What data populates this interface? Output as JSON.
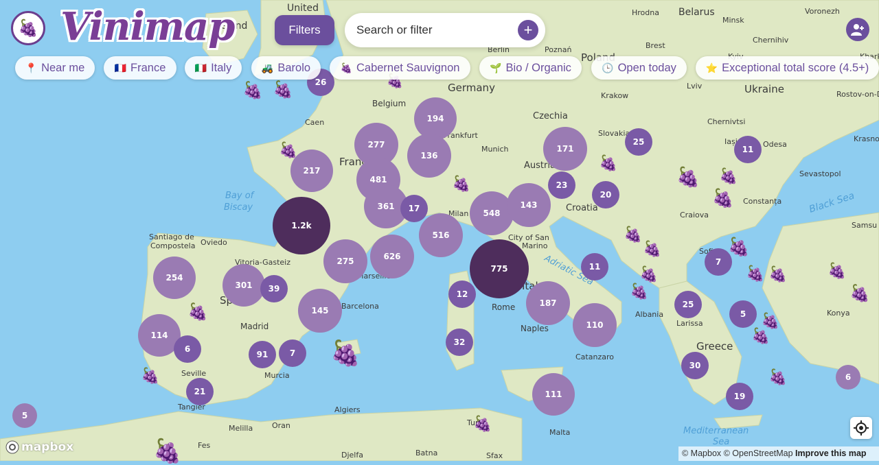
{
  "app": {
    "name": "Vinimap"
  },
  "header": {
    "filters_label": "Filters",
    "search_placeholder": "Search or filter",
    "search_add": "+"
  },
  "chips": [
    {
      "emoji": "📍",
      "label": "Near me"
    },
    {
      "emoji": "🇫🇷",
      "label": "France"
    },
    {
      "emoji": "🇮🇹",
      "label": "Italy"
    },
    {
      "emoji": "🚜",
      "label": "Barolo"
    },
    {
      "emoji": "🍇",
      "label": "Cabernet Sauvignon"
    },
    {
      "emoji": "🌱",
      "label": "Bio / Organic"
    },
    {
      "emoji": "🕒",
      "label": "Open today"
    },
    {
      "emoji": "⭐",
      "label": "Exceptional total score (4.5+)"
    }
  ],
  "place_labels": [
    "United",
    "Ireland",
    "Belarus",
    "Hrodna",
    "Voronezh",
    "Minsk",
    "Chernihiv",
    "Brest",
    "Poznań",
    "Berlin",
    "Poland",
    "Kyiv",
    "Rostov-on-D",
    "Germany",
    "Ukraine",
    "Belgium",
    "Lviv",
    "Krakow",
    "Kharkiv",
    "Czechia",
    "Caen",
    "Frankfurt",
    "Munich",
    "Slovakia",
    "Chernivtsi",
    "Iași",
    "Odesa",
    "Krasnod",
    "Austria",
    "Sevastopol",
    "France",
    "Croatia",
    "Constanța",
    "Bay of",
    "Biscay",
    "Milan",
    "Craiova",
    "Santiago de",
    "Compostela",
    "Oviedo",
    "City of San",
    "Marino",
    "Sofia",
    "Samsu",
    "Vitoria-Gasteiz",
    "Spain",
    "Marseille",
    "Barcelona",
    "Madrid",
    "Italy",
    "Rome",
    "Albania",
    "Larissa",
    "Konya",
    "Naples",
    "Greece",
    "Catanzaro",
    "Seville",
    "Murcia",
    "Tangier",
    "Algiers",
    "Malta",
    "Melilla",
    "Oran",
    "Tunis",
    "Sfax",
    "Fes",
    "Djelfa",
    "Batna",
    "Mediterranean",
    "Sea",
    "Adriatic Sea",
    "Black Sea"
  ],
  "clusters": [
    {
      "label": "26",
      "tone": "mid"
    },
    {
      "label": "194",
      "tone": "light"
    },
    {
      "label": "277",
      "tone": "light"
    },
    {
      "label": "136",
      "tone": "light"
    },
    {
      "label": "171",
      "tone": "light"
    },
    {
      "label": "25",
      "tone": "mid"
    },
    {
      "label": "11",
      "tone": "mid"
    },
    {
      "label": "217",
      "tone": "light"
    },
    {
      "label": "481",
      "tone": "light"
    },
    {
      "label": "23",
      "tone": "mid"
    },
    {
      "label": "20",
      "tone": "mid"
    },
    {
      "label": "361",
      "tone": "light"
    },
    {
      "label": "17",
      "tone": "mid"
    },
    {
      "label": "548",
      "tone": "light"
    },
    {
      "label": "143",
      "tone": "light"
    },
    {
      "label": "1.2k",
      "tone": "dark"
    },
    {
      "label": "516",
      "tone": "light"
    },
    {
      "label": "626",
      "tone": "light"
    },
    {
      "label": "275",
      "tone": "light"
    },
    {
      "label": "775",
      "tone": "dark"
    },
    {
      "label": "11",
      "tone": "mid"
    },
    {
      "label": "7",
      "tone": "mid"
    },
    {
      "label": "254",
      "tone": "light"
    },
    {
      "label": "301",
      "tone": "light"
    },
    {
      "label": "39",
      "tone": "mid"
    },
    {
      "label": "12",
      "tone": "mid"
    },
    {
      "label": "187",
      "tone": "light"
    },
    {
      "label": "25",
      "tone": "mid"
    },
    {
      "label": "5",
      "tone": "mid"
    },
    {
      "label": "145",
      "tone": "light"
    },
    {
      "label": "110",
      "tone": "light"
    },
    {
      "label": "114",
      "tone": "light"
    },
    {
      "label": "6",
      "tone": "mid"
    },
    {
      "label": "32",
      "tone": "mid"
    },
    {
      "label": "91",
      "tone": "mid"
    },
    {
      "label": "7",
      "tone": "mid"
    },
    {
      "label": "30",
      "tone": "mid"
    },
    {
      "label": "6",
      "tone": "light"
    },
    {
      "label": "21",
      "tone": "mid"
    },
    {
      "label": "111",
      "tone": "light"
    },
    {
      "label": "19",
      "tone": "mid"
    },
    {
      "label": "5",
      "tone": "light"
    }
  ],
  "colors": {
    "dark": "#4e2d5c",
    "mid": "#7a5aa6",
    "light": "#9a7bb3",
    "brand": "#6b4f9d"
  },
  "footer": {
    "mapbox_label": "mapbox",
    "attribution": "© Mapbox © OpenStreetMap",
    "improve": "Improve this map"
  }
}
